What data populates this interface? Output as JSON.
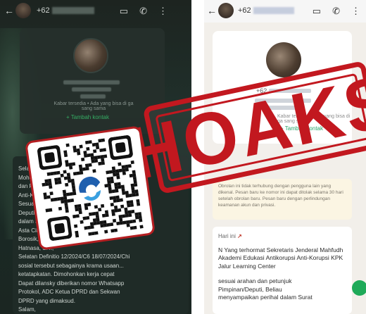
{
  "left_screen": {
    "phone_prefix": "+62",
    "contact_subtitle": "Kabar tersedia • Ada yang bisa di ga sang sama",
    "add_contact": "+ Tambah kontak",
    "message_lines": [
      "Selam...",
      "",
      "Mohon...",
      "dan Pu...",
      "Anti-Ko...",
      "Sesuai a...",
      "Deputi, B...",
      "dalam Sur...",
      "Asta Cita K...",
      "Borosik, Dire...",
      "Hatnasa, S.T.,",
      "Selatan Definitio 12/2024/C6 18/07/2024/Chi",
      "sosial tersebut sebagainya krama usaan...",
      "ketatapkatan. Dimohonkan kerja cepat",
      "Dapat dilansky diberikan nomor Whatsapp",
      "Protokol, ADC Ketua DPRD dan Sekwan",
      "DPRD yang dimaksud.",
      "",
      "Salam,"
    ]
  },
  "right_screen": {
    "phone_prefix": "+62",
    "contact_subtitle": "Kabar tersedia • Ada yang bisa di ga sang sama",
    "add_contact": "+ Tambah kontak",
    "security_note": "Obrolan ini tidak terhubung dengan pengguna lain yang dikenal. Pesan baru ke nomor ini dapat ditolak selama 30 hari setelah obrolan baru. Pesan baru dengan perlindungan keamanan akun dan privasi.",
    "message_header": "Hari ini",
    "message_lines": [
      "N Yang terhormat Sekretaris Jenderal Mahfudh",
      "Akademi Edukasi Antikorupsi Anti-Korupsi KPK",
      "Jalur Learning Center",
      "",
      "sesuai arahan dan petunjuk",
      "Pimpinan/Deputi, Beliau",
      "menyampaikan perihal dalam Surat"
    ]
  },
  "stamp": {
    "text": "HOAKS",
    "color": "#c2181f"
  },
  "colors": {
    "whatsapp_green": "#1faa59",
    "stamp_red": "#c2181f",
    "kominfo_blue": "#1f5fae"
  }
}
